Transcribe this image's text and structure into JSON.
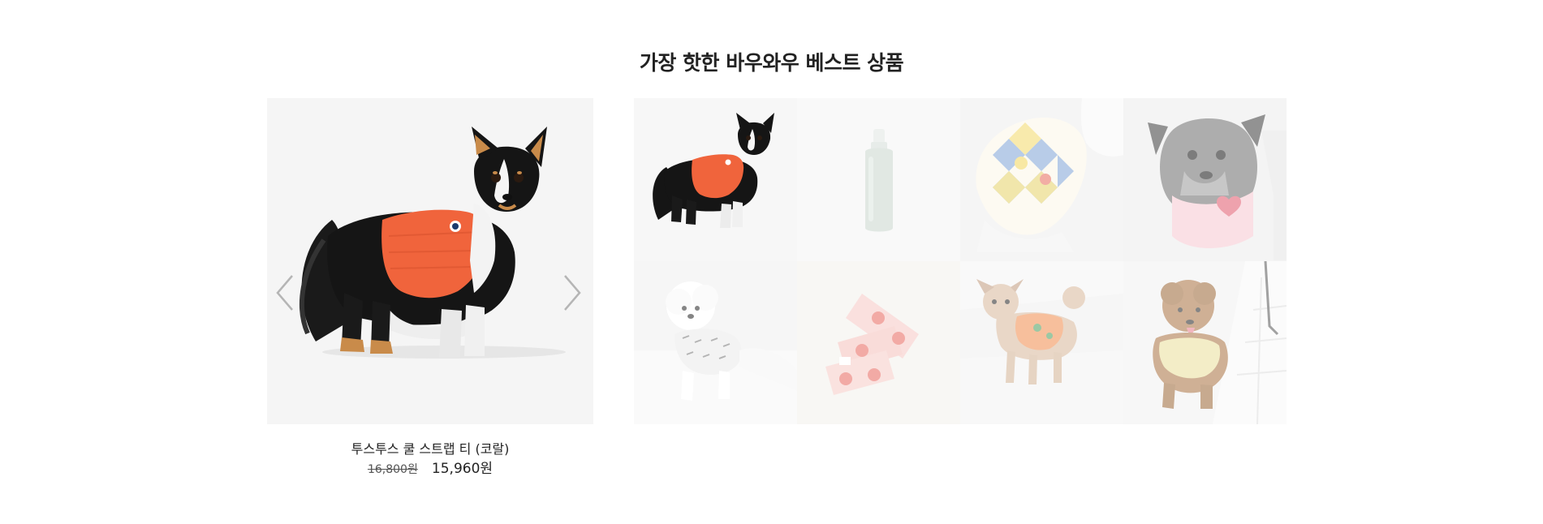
{
  "section": {
    "title": "가장 핫한 바우와우 베스트 상품"
  },
  "featured": {
    "product_name": "투스투스 쿨 스트랩 티 (코랄)",
    "price_original": "16,800원",
    "price_sale": "15,960원",
    "image_icon": "dog-in-coral-tee-image",
    "prev_icon": "chevron-left-icon",
    "next_icon": "chevron-right-icon"
  },
  "thumbnails": [
    {
      "image": "chihuahua-coral-tee",
      "active": true
    },
    {
      "image": "mint-spray-bottle",
      "active": false
    },
    {
      "image": "argyle-pattern-tee",
      "active": false
    },
    {
      "image": "schnauzer-pink-bib",
      "active": false
    },
    {
      "image": "bichon-printed-tee",
      "active": false
    },
    {
      "image": "pink-heart-scarf",
      "active": false
    },
    {
      "image": "poodle-orange-top",
      "active": false
    },
    {
      "image": "poodle-yellow-vest",
      "active": false
    }
  ],
  "colors": {
    "coral": "#f0643c",
    "panel_bg": "#f5f5f5",
    "arrow": "#b5b5b5"
  }
}
